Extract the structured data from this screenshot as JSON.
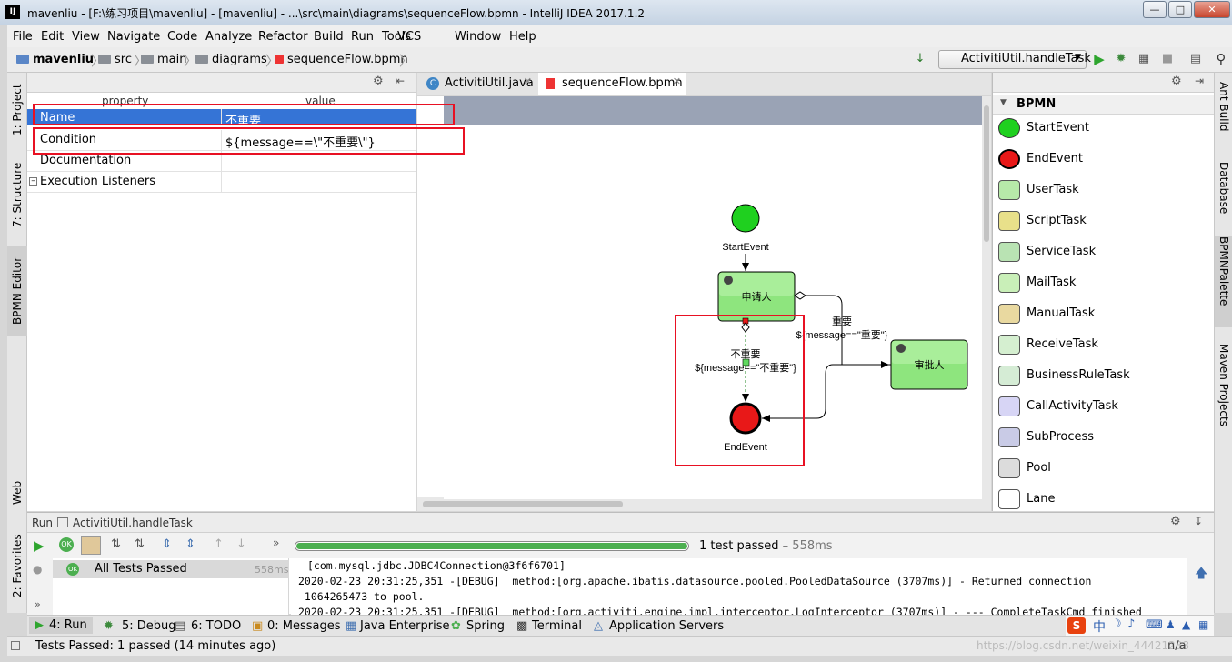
{
  "window": {
    "title": "mavenliu - [F:\\练习项目\\mavenliu] - [mavenliu] - ...\\src\\main\\diagrams\\sequenceFlow.bpmn - IntelliJ IDEA 2017.1.2",
    "app_icon": "IJ"
  },
  "menu": [
    "File",
    "Edit",
    "View",
    "Navigate",
    "Code",
    "Analyze",
    "Refactor",
    "Build",
    "Run",
    "Tools",
    "VCS",
    "Window",
    "Help"
  ],
  "breadcrumbs": [
    "mavenliu",
    "src",
    "main",
    "diagrams",
    "sequenceFlow.bpmn"
  ],
  "run_config": "ActivitiUtil.handleTask",
  "left_stripe": [
    "1: Project",
    "7: Structure",
    "BPMN Editor",
    "Web",
    "2: Favorites"
  ],
  "right_stripe": [
    "Ant Build",
    "Database",
    "BPMNPalette",
    "Maven Projects"
  ],
  "properties": {
    "headers": [
      "property",
      "value"
    ],
    "rows": [
      {
        "key": "Name",
        "value": "不重要"
      },
      {
        "key": "Condition",
        "value": "${message==\\\"不重要\\\"}"
      },
      {
        "key": "Documentation",
        "value": ""
      },
      {
        "key": "Execution Listeners",
        "value": ""
      }
    ]
  },
  "editor_tabs": [
    {
      "label": "ActivitiUtil.java",
      "icon": "class-icon",
      "active": false
    },
    {
      "label": "sequenceFlow.bpmn",
      "icon": "bpmn-icon",
      "active": true
    }
  ],
  "diagram": {
    "start_label": "StartEvent",
    "task1": "申请人",
    "task2": "审批人",
    "end_label": "EndEvent",
    "flow1_name": "重要",
    "flow1_cond": "${message==\"重要\"}",
    "flow2_name": "不重要",
    "flow2_cond": "${message==\"不重要\"}"
  },
  "palette": {
    "header": "BPMN",
    "items": [
      {
        "label": "StartEvent",
        "color": "#1fd01f"
      },
      {
        "label": "EndEvent",
        "color": "#e81818"
      },
      {
        "label": "UserTask",
        "color": "#b7e9a9"
      },
      {
        "label": "ScriptTask",
        "color": "#e8e08a"
      },
      {
        "label": "ServiceTask",
        "color": "#b9e3b3"
      },
      {
        "label": "MailTask",
        "color": "#c9efb8"
      },
      {
        "label": "ManualTask",
        "color": "#e9d9a0"
      },
      {
        "label": "ReceiveTask",
        "color": "#d5efd0"
      },
      {
        "label": "BusinessRuleTask",
        "color": "#d5ecd5"
      },
      {
        "label": "CallActivityTask",
        "color": "#d7d5f5"
      },
      {
        "label": "SubProcess",
        "color": "#c9cbe6"
      },
      {
        "label": "Pool",
        "color": "#dcdcdc"
      },
      {
        "label": "Lane",
        "color": "#ffffff"
      }
    ]
  },
  "run": {
    "title": "Run",
    "config": "ActivitiUtil.handleTask",
    "progress": 1.0,
    "summary": "1 test passed",
    "duration": "558ms",
    "tree_item": "All Tests Passed",
    "tree_time": "558ms",
    "console": [
      "[com.mysql.jdbc.JDBC4Connection@3f6f6701]",
      "2020-02-23 20:31:25,351 -[DEBUG]  method:[org.apache.ibatis.datasource.pooled.PooledDataSource (3707ms)] - Returned connection",
      " 1064265473 to pool.",
      "2020-02-23 20:31:25,351 -[DEBUG]  method:[org.activiti.engine.impl.interceptor.LogInterceptor (3707ms)] - --- CompleteTaskCmd finished"
    ]
  },
  "bottom_tabs": [
    "4: Run",
    "5: Debug",
    "6: TODO",
    "0: Messages",
    "Java Enterprise",
    "Spring",
    "Terminal",
    "Application Servers"
  ],
  "status": {
    "text": "Tests Passed: 1 passed (14 minutes ago)",
    "right": "n/a",
    "watermark": "https://blog.csdn.net/weixin_44421238"
  },
  "ime": [
    "中",
    "♪"
  ]
}
